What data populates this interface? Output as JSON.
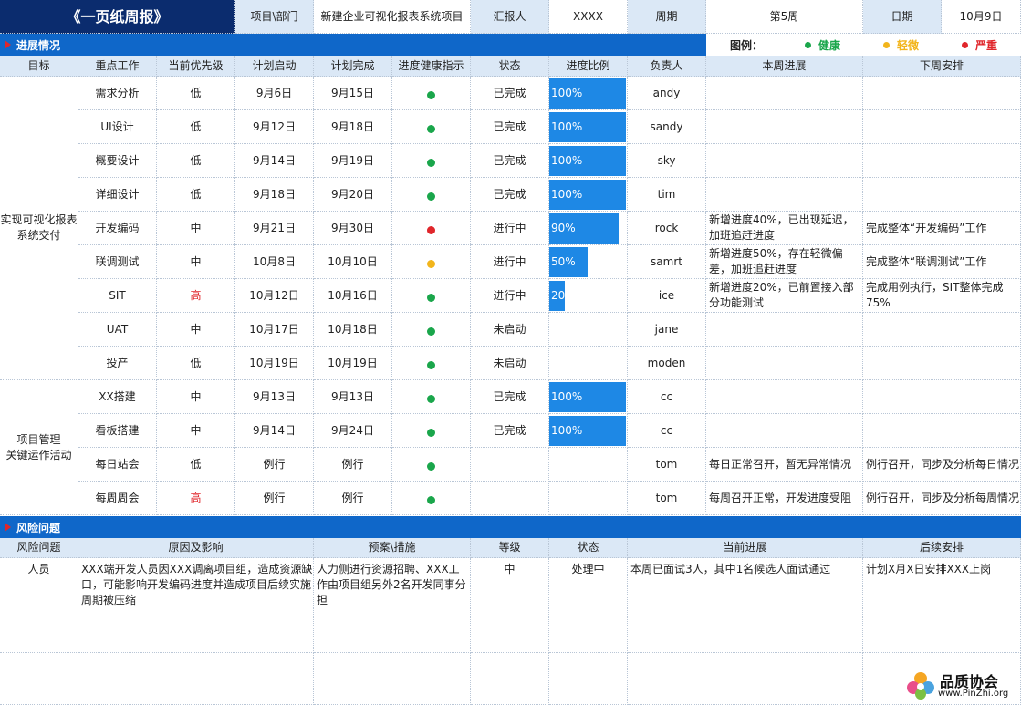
{
  "header": {
    "title": "《一页纸周报》",
    "project_label": "项目\\部门",
    "project_value": "新建企业可视化报表系统项目",
    "reporter_label": "汇报人",
    "reporter_value": "XXXX",
    "period_label": "周期",
    "period_value": "第5周",
    "date_label": "日期",
    "date_value": "10月9日"
  },
  "progress_section": {
    "title": "进展情况",
    "legend_label": "图例：",
    "legend": [
      {
        "label": "健康",
        "color": "#1aa64b"
      },
      {
        "label": "轻微",
        "color": "#f2b51c"
      },
      {
        "label": "严重",
        "color": "#e0262b"
      }
    ],
    "columns": [
      "目标",
      "重点工作",
      "当前优先级",
      "计划启动",
      "计划完成",
      "进度健康指示",
      "状态",
      "进度比例",
      "负责人",
      "本周进展",
      "下周安排"
    ],
    "groups": [
      {
        "goal": "实现可视化报表系统交付"
      },
      {
        "goal": "项目管理\n关键运作活动"
      }
    ],
    "rows": [
      {
        "task": "需求分析",
        "priority": "低",
        "start": "9月6日",
        "end": "9月15日",
        "health": "#1aa64b",
        "status": "已完成",
        "progress": 1.0,
        "progress_label": "100%",
        "owner": "andy",
        "this_week": "",
        "next_week": ""
      },
      {
        "task": "UI设计",
        "priority": "低",
        "start": "9月12日",
        "end": "9月18日",
        "health": "#1aa64b",
        "status": "已完成",
        "progress": 1.0,
        "progress_label": "100%",
        "owner": "sandy",
        "this_week": "",
        "next_week": ""
      },
      {
        "task": "概要设计",
        "priority": "低",
        "start": "9月14日",
        "end": "9月19日",
        "health": "#1aa64b",
        "status": "已完成",
        "progress": 1.0,
        "progress_label": "100%",
        "owner": "sky",
        "this_week": "",
        "next_week": ""
      },
      {
        "task": "详细设计",
        "priority": "低",
        "start": "9月18日",
        "end": "9月20日",
        "health": "#1aa64b",
        "status": "已完成",
        "progress": 1.0,
        "progress_label": "100%",
        "owner": "tim",
        "this_week": "",
        "next_week": ""
      },
      {
        "task": "开发编码",
        "priority": "中",
        "start": "9月21日",
        "end": "9月30日",
        "health": "#e0262b",
        "status": "进行中",
        "progress": 0.9,
        "progress_label": "90%",
        "owner": "rock",
        "this_week": "新增进度40%，已出现延迟，加班追赶进度",
        "next_week": "完成整体“开发编码”工作"
      },
      {
        "task": "联调测试",
        "priority": "中",
        "start": "10月8日",
        "end": "10月10日",
        "health": "#f2b51c",
        "status": "进行中",
        "progress": 0.5,
        "progress_label": "50%",
        "owner": "samrt",
        "this_week": "新增进度50%，存在轻微偏差，加班追赶进度",
        "next_week": "完成整体“联调测试”工作"
      },
      {
        "task": "SIT",
        "priority": "高",
        "start": "10月12日",
        "end": "10月16日",
        "health": "#1aa64b",
        "status": "进行中",
        "progress": 0.2,
        "progress_label": "20%",
        "owner": "ice",
        "this_week": "新增进度20%，已前置接入部分功能测试",
        "next_week": "完成用例执行，SIT整体完成75%"
      },
      {
        "task": "UAT",
        "priority": "中",
        "start": "10月17日",
        "end": "10月18日",
        "health": "#1aa64b",
        "status": "未启动",
        "progress": 0,
        "progress_label": "",
        "owner": "jane",
        "this_week": "",
        "next_week": ""
      },
      {
        "task": "投产",
        "priority": "低",
        "start": "10月19日",
        "end": "10月19日",
        "health": "#1aa64b",
        "status": "未启动",
        "progress": 0,
        "progress_label": "",
        "owner": "moden",
        "this_week": "",
        "next_week": ""
      },
      {
        "task": "XX搭建",
        "priority": "中",
        "start": "9月13日",
        "end": "9月13日",
        "health": "#1aa64b",
        "status": "已完成",
        "progress": 1.0,
        "progress_label": "100%",
        "owner": "cc",
        "this_week": "",
        "next_week": ""
      },
      {
        "task": "看板搭建",
        "priority": "中",
        "start": "9月14日",
        "end": "9月24日",
        "health": "#1aa64b",
        "status": "已完成",
        "progress": 1.0,
        "progress_label": "100%",
        "owner": "cc",
        "this_week": "",
        "next_week": ""
      },
      {
        "task": "每日站会",
        "priority": "低",
        "start": "例行",
        "end": "例行",
        "health": "#1aa64b",
        "status": "",
        "progress": 0,
        "progress_label": "",
        "owner": "tom",
        "this_week": "每日正常召开，暂无异常情况",
        "next_week": "例行召开，同步及分析每日情况"
      },
      {
        "task": "每周周会",
        "priority": "高",
        "start": "例行",
        "end": "例行",
        "health": "#1aa64b",
        "status": "",
        "progress": 0,
        "progress_label": "",
        "owner": "tom",
        "this_week": "每周召开正常，开发进度受阻",
        "next_week": "例行召开，同步及分析每周情况"
      }
    ]
  },
  "risk_section": {
    "title": "风险问题",
    "columns": [
      "风险问题",
      "原因及影响",
      "预案\\措施",
      "等级",
      "状态",
      "当前进展",
      "后续安排"
    ],
    "rows": [
      {
        "issue": "人员",
        "cause": "XXX端开发人员因XXX调离项目组，造成资源缺口，可能影响开发编码进度并造成项目后续实施周期被压缩",
        "measure": "人力侧进行资源招聘、XXX工作由项目组另外2名开发同事分担",
        "level": "中",
        "status": "处理中",
        "progress": "本周已面试3人，其中1名候选人面试通过",
        "next": "计划X月X日安排XXX上岗"
      }
    ]
  },
  "watermark": {
    "name": "品质协会",
    "url": "www.PinZhi.org"
  },
  "colors": {
    "header_bg": "#0b2c6e",
    "section_bg": "#0f67c9",
    "label_bg": "#dbe8f6",
    "bar": "#1e88e5",
    "high_priority": "#e0262b"
  }
}
